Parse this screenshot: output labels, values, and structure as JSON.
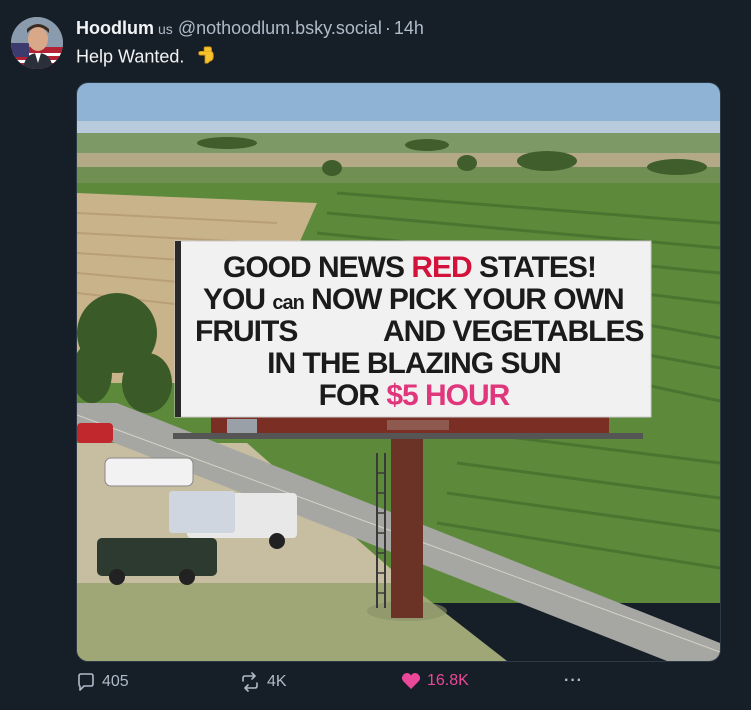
{
  "author": {
    "display_name": "Hoodlum",
    "badge": "us",
    "handle": "@nothoodlum.bsky.social",
    "separator": "·",
    "time": "14h",
    "avatar_icon": "avatar-portrait-icon"
  },
  "post": {
    "text": "Help Wanted.",
    "emoji_icon": "pointing-down-hand-icon"
  },
  "billboard": {
    "line1_a": "GOOD NEWS",
    "line1_red": "RED",
    "line1_b": "STATES!",
    "line2_a": "YOU",
    "line2_small": "can",
    "line2_b": "NOW PICK YOUR OWN",
    "line3_a": "FRUITS",
    "line3_b": "AND VEGETABLES",
    "line4": "IN THE BLAZING SUN",
    "line5_a": "FOR",
    "line5_pink": "$5 HOUR"
  },
  "actions": {
    "reply_count": "405",
    "repost_count": "4K",
    "like_count": "16.8K",
    "more_label": "···"
  },
  "colors": {
    "background": "#161e27",
    "muted": "#aebbc9",
    "like": "#ec4899",
    "billboard_red": "#d3123b",
    "billboard_pink": "#e0367b"
  }
}
